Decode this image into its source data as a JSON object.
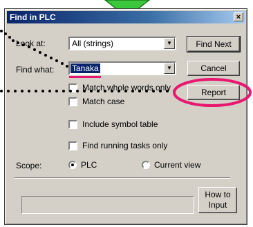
{
  "dialog": {
    "title": "Find in PLC",
    "close_glyph": "×"
  },
  "fields": {
    "look_at_label": "Look at:",
    "look_at_value": "All (strings)",
    "find_what_label": "Find what:",
    "find_what_value": "Tanaka"
  },
  "buttons": {
    "find_next": "Find Next",
    "cancel": "Cancel",
    "report": "Report",
    "how_to_input_line1": "How to",
    "how_to_input_line2": "Input"
  },
  "options": {
    "match_whole_words": "Match whole words only",
    "match_case": "Match case",
    "include_symbol_table": "Include symbol table",
    "find_running_tasks": "Find running tasks only"
  },
  "scope": {
    "label": "Scope:",
    "plc": "PLC",
    "current_view": "Current view",
    "selected": "PLC"
  },
  "annotation": {
    "highlight_color": "#e8176f",
    "arrow_color": "#3cc83c",
    "dot_color": "#000000"
  }
}
